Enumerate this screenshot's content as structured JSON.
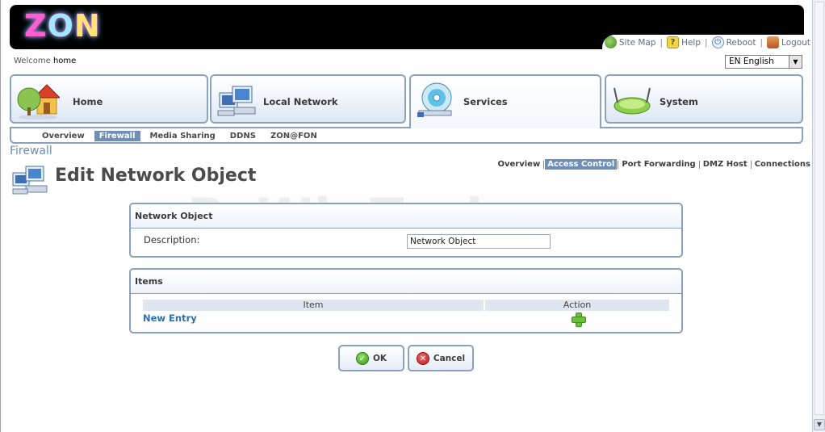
{
  "header": {
    "logo": "ZON",
    "links": [
      {
        "label": "Site Map",
        "icon": "sitemap-icon"
      },
      {
        "label": "Help",
        "icon": "help-icon"
      },
      {
        "label": "Reboot",
        "icon": "reboot-icon"
      },
      {
        "label": "Logout",
        "icon": "logout-icon"
      }
    ],
    "separator": "|"
  },
  "welcome": {
    "prefix": "Welcome",
    "user": "home"
  },
  "language": {
    "selected": "EN English"
  },
  "main_tabs": [
    {
      "label": "Home",
      "icon": "house-icon",
      "active": false
    },
    {
      "label": "Local Network",
      "icon": "computers-icon",
      "active": false
    },
    {
      "label": "Services",
      "icon": "disc-icon",
      "active": true
    },
    {
      "label": "System",
      "icon": "router-icon",
      "active": false
    }
  ],
  "subnav": [
    {
      "label": "Overview",
      "active": false
    },
    {
      "label": "Firewall",
      "active": true
    },
    {
      "label": "Media Sharing",
      "active": false
    },
    {
      "label": "DDNS",
      "active": false
    },
    {
      "label": "ZON@FON",
      "active": false
    }
  ],
  "section": "Firewall",
  "page_title": "Edit Network Object",
  "right_nav": [
    {
      "label": "Overview",
      "active": false
    },
    {
      "label": "Access Control",
      "active": true
    },
    {
      "label": "Port Forwarding",
      "active": false
    },
    {
      "label": "DMZ Host",
      "active": false
    },
    {
      "label": "Connections",
      "active": false
    }
  ],
  "network_object": {
    "title": "Network Object",
    "description_label": "Description:",
    "description_value": "Network Object"
  },
  "items": {
    "title": "Items",
    "col_item": "Item",
    "col_action": "Action",
    "new_entry": "New Entry"
  },
  "buttons": {
    "ok": "OK",
    "cancel": "Cancel"
  },
  "watermark": "PcWinTech.com",
  "colors": {
    "accent": "#6f8fb8",
    "border": "#8aa2c0",
    "link": "#2c6fae"
  }
}
